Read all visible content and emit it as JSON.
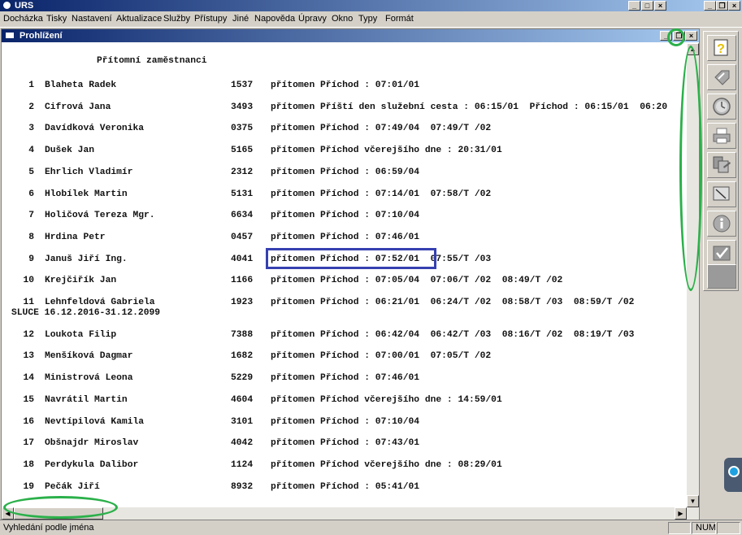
{
  "app": {
    "title": "URS"
  },
  "menu": [
    "Docházka",
    "Tisky",
    "Nastavení",
    "Aktualizace",
    "Služby",
    "Přístupy",
    "Jiné",
    "Napověda",
    "Úpravy",
    "Okno",
    "Typy",
    "Formát"
  ],
  "document": {
    "title": "Prohlížení",
    "report_title": "Přítomní zaměstnanci",
    "rows": [
      {
        "num": "1",
        "name": "Blaheta Radek",
        "code": "1537",
        "status": "přítomen Příchod : 07:01/01"
      },
      {
        "num": "2",
        "name": "Cifrová Jana",
        "code": "3493",
        "status": "přítomen Příští den služební cesta : 06:15/01  Příchod : 06:15/01  06:20"
      },
      {
        "num": "3",
        "name": "Davídková Veronika",
        "code": "0375",
        "status": "přítomen Příchod : 07:49/04  07:49/T /02"
      },
      {
        "num": "4",
        "name": "Dušek Jan",
        "code": "5165",
        "status": "přítomen Příchod včerejšího dne : 20:31/01"
      },
      {
        "num": "5",
        "name": "Ehrlich Vladimír",
        "code": "2312",
        "status": "přítomen Příchod : 06:59/04"
      },
      {
        "num": "6",
        "name": "Hlobílek Martin",
        "code": "5131",
        "status": "přítomen Příchod : 07:14/01  07:58/T /02"
      },
      {
        "num": "7",
        "name": "Holičová Tereza Mgr.",
        "code": "6634",
        "status": "přítomen Příchod : 07:10/04"
      },
      {
        "num": "8",
        "name": "Hrdina Petr",
        "code": "0457",
        "status": "přítomen Příchod : 07:46/01"
      },
      {
        "num": "9",
        "name": "Januš Jiří Ing.",
        "code": "4041",
        "status": "přítomen Příchod : 07:52/01  07:55/T /03"
      },
      {
        "num": "10",
        "name": "Krejčiřík Jan",
        "code": "1166",
        "status": "přítomen Příchod : 07:05/04  07:06/T /02  08:49/T /02"
      },
      {
        "num": "11",
        "name": "Lehnfeldová Gabriela",
        "code": "1923",
        "status": "přítomen Příchod : 06:21/01  06:24/T /02  08:58/T /03  08:59/T /02"
      },
      {
        "num": "12",
        "name": "Loukota Filip",
        "code": "7388",
        "status": "přítomen Příchod : 06:42/04  06:42/T /03  08:16/T /02  08:19/T /03"
      },
      {
        "num": "13",
        "name": "Menšíková Dagmar",
        "code": "1682",
        "status": "přítomen Příchod : 07:00/01  07:05/T /02"
      },
      {
        "num": "14",
        "name": "Ministrová Leona",
        "code": "5229",
        "status": "přítomen Příchod : 07:46/01"
      },
      {
        "num": "15",
        "name": "Navrátil Martin",
        "code": "4604",
        "status": "přítomen Příchod včerejšího dne : 14:59/01"
      },
      {
        "num": "16",
        "name": "Nevtípilová Kamila",
        "code": "3101",
        "status": "přítomen Příchod : 07:10/04"
      },
      {
        "num": "17",
        "name": "Obšnajdr Miroslav",
        "code": "4042",
        "status": "přítomen Příchod : 07:43/01"
      },
      {
        "num": "18",
        "name": "Perdykula Dalibor",
        "code": "1124",
        "status": "přítomen Příchod včerejšího dne : 08:29/01"
      },
      {
        "num": "19",
        "name": "Pečák Jiří",
        "code": "8932",
        "status": "přítomen Příchod : 05:41/01"
      }
    ],
    "row11_extra": "SLUCE 16.12.2016-31.12.2099"
  },
  "toolbar": {
    "icons": [
      "help-icon",
      "tag-icon",
      "clock-icon",
      "printer-icon",
      "documents-icon",
      "edit-icon",
      "info-icon",
      "check-icon",
      "blank-icon"
    ]
  },
  "statusbar": {
    "text": "Vyhledání podle jména",
    "num": "NUM"
  },
  "colors": {
    "highlight": "#3640b0",
    "annotation": "#2bb04a",
    "titlebar": "#0a246a"
  }
}
